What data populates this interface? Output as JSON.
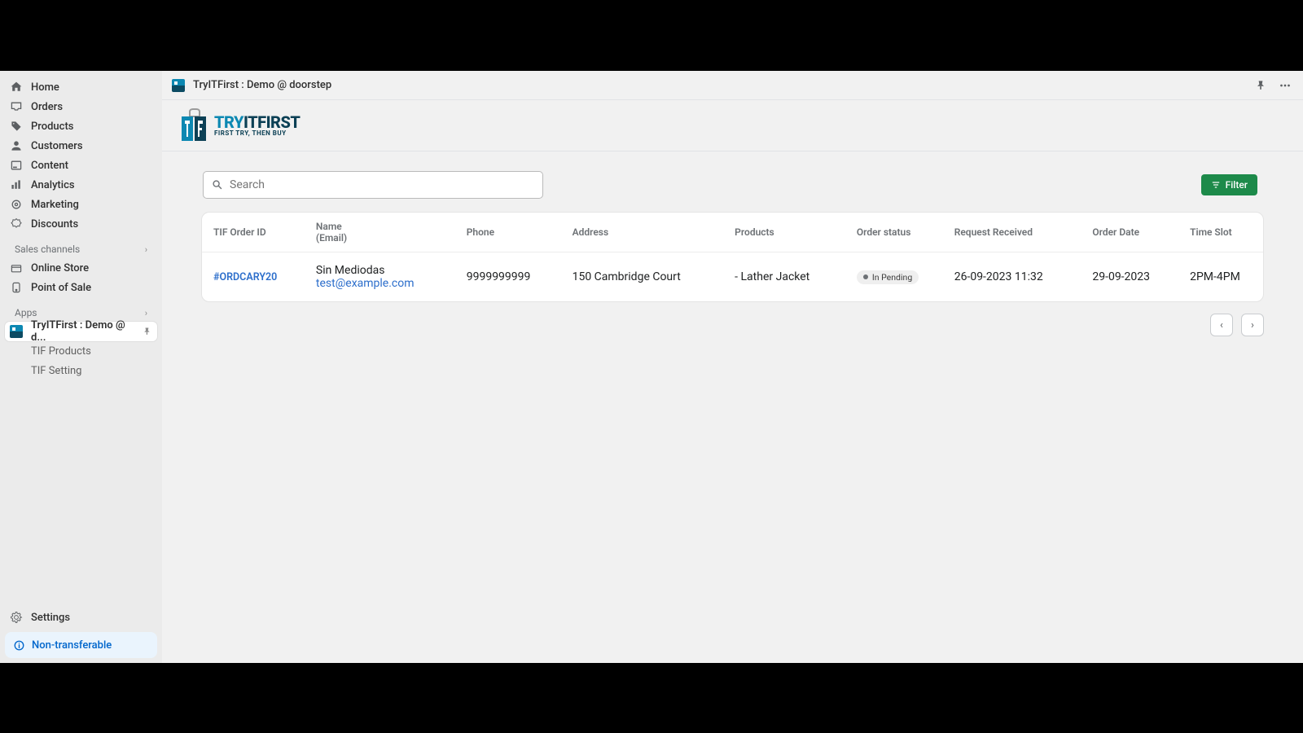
{
  "header": {
    "app_title": "TryITFirst : Demo @ doorstep"
  },
  "sidebar": {
    "items": [
      {
        "label": "Home"
      },
      {
        "label": "Orders"
      },
      {
        "label": "Products"
      },
      {
        "label": "Customers"
      },
      {
        "label": "Content"
      },
      {
        "label": "Analytics"
      },
      {
        "label": "Marketing"
      },
      {
        "label": "Discounts"
      }
    ],
    "sales_section": "Sales channels",
    "sales_items": [
      {
        "label": "Online Store"
      },
      {
        "label": "Point of Sale"
      }
    ],
    "apps_section": "Apps",
    "app_active": {
      "label": "TryITFirst : Demo @ d..."
    },
    "app_subs": [
      {
        "label": "TIF Products"
      },
      {
        "label": "TIF Setting"
      }
    ],
    "settings_label": "Settings",
    "non_transferable": "Non-transferable"
  },
  "logo_text": {
    "brand1": "TRY",
    "brand2": "IT",
    "brand3": "FIRST",
    "tagline": "FIRST TRY, THEN BUY"
  },
  "toolbar": {
    "search_placeholder": "Search",
    "filter_label": "Filter"
  },
  "table": {
    "columns": {
      "order_id": "TIF Order ID",
      "name": "Name",
      "email": "(Email)",
      "phone": "Phone",
      "address": "Address",
      "products": "Products",
      "status": "Order status",
      "received": "Request Received",
      "order_date": "Order Date",
      "time_slot": "Time Slot"
    },
    "rows": [
      {
        "order_id": "#ORDCARY20",
        "name": "Sin Mediodas",
        "email": "test@example.com",
        "phone": "9999999999",
        "address": "150 Cambridge Court",
        "products": "- Lather Jacket",
        "status": "In Pending",
        "received": "26-09-2023 11:32",
        "order_date": "29-09-2023",
        "time_slot": "2PM-4PM"
      }
    ]
  }
}
